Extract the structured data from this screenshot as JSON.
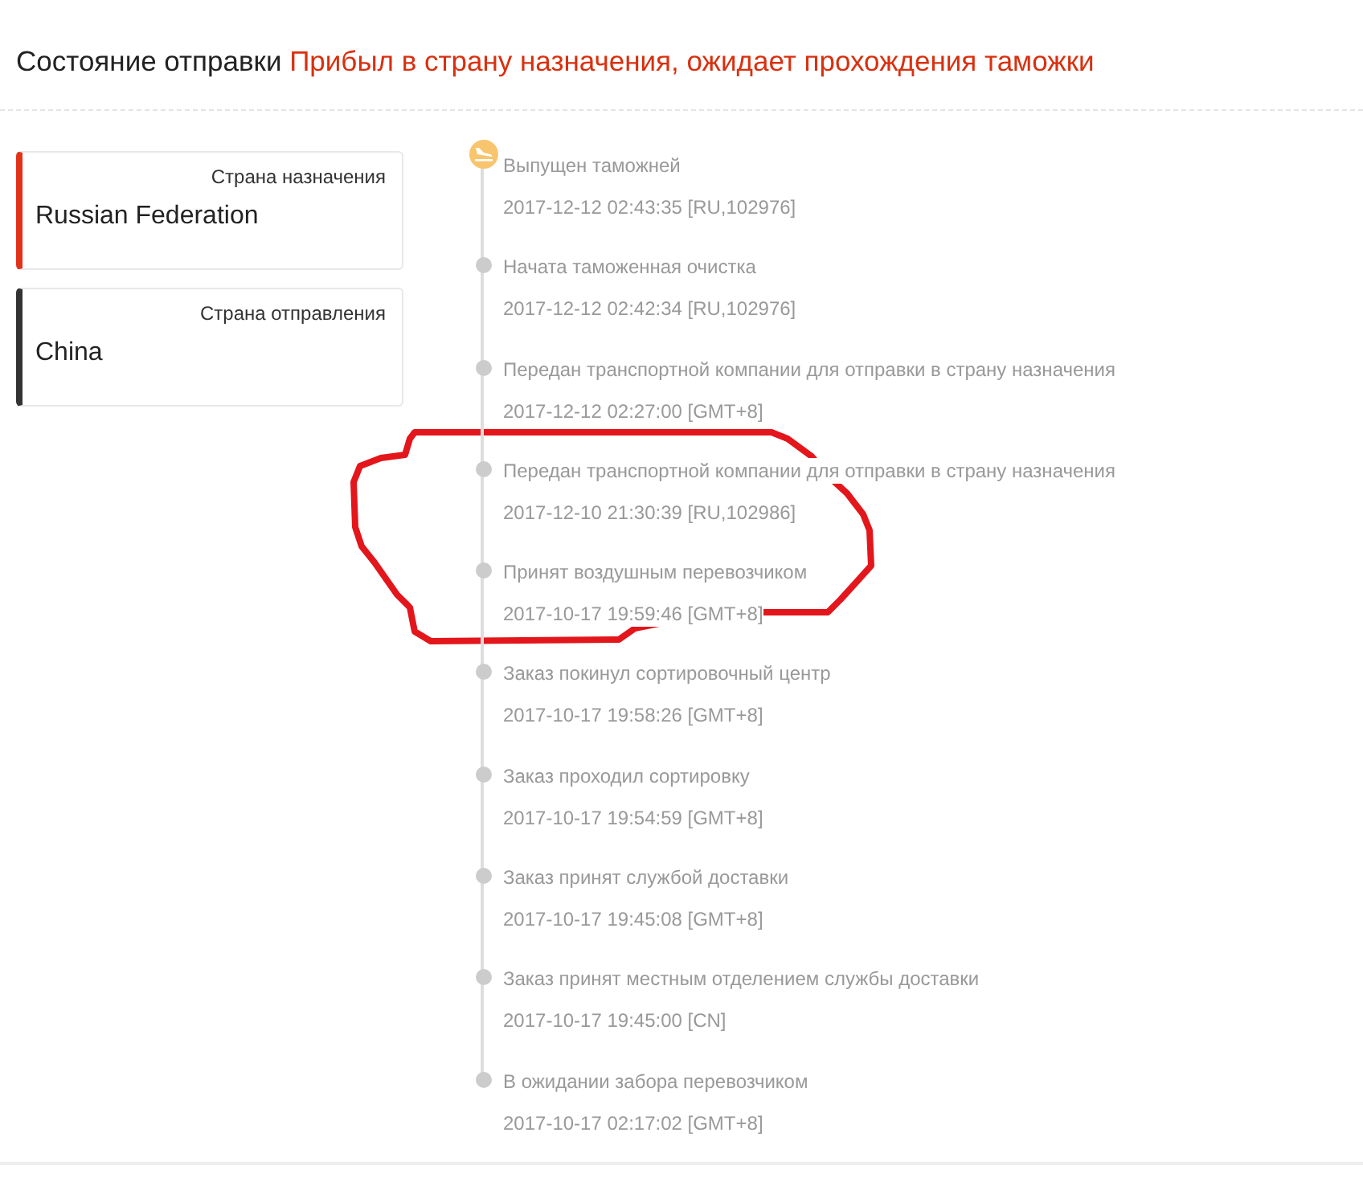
{
  "header": {
    "label": "Состояние отправки",
    "status": "Прибыл в страну назначения, ожидает прохождения таможки"
  },
  "countries": [
    {
      "label": "Страна назначения",
      "value": "Russian Federation",
      "color": "#e0331a"
    },
    {
      "label": "Страна отправления",
      "value": "China",
      "color": "#333333"
    }
  ],
  "events": [
    {
      "title": "Выпущен таможней",
      "time": "2017-12-12 02:43:35 [RU,102976]",
      "active": true
    },
    {
      "title": "Начата таможенная очистка",
      "time": "2017-12-12 02:42:34 [RU,102976]",
      "active": false
    },
    {
      "title": "Передан транспортной компании для отправки в страну назначения",
      "time": "2017-12-12 02:27:00 [GMT+8]",
      "active": false
    },
    {
      "title": "Передан транспортной компании для отправки в страну назначения",
      "time": "2017-12-10 21:30:39 [RU,102986]",
      "active": false
    },
    {
      "title": "Принят воздушным перевозчиком",
      "time": "2017-10-17 19:59:46 [GMT+8]",
      "active": false
    },
    {
      "title": "Заказ покинул сортировочный центр",
      "time": "2017-10-17 19:58:26 [GMT+8]",
      "active": false
    },
    {
      "title": "Заказ проходил сортировку",
      "time": "2017-10-17 19:54:59 [GMT+8]",
      "active": false
    },
    {
      "title": "Заказ принят службой доставки",
      "time": "2017-10-17 19:45:08 [GMT+8]",
      "active": false
    },
    {
      "title": "Заказ принят местным отделением службы доставки",
      "time": "2017-10-17 19:45:00 [CN]",
      "active": false
    },
    {
      "title": "В ожидании забора перевозчиком",
      "time": "2017-10-17 02:17:02 [GMT+8]",
      "active": false
    }
  ]
}
